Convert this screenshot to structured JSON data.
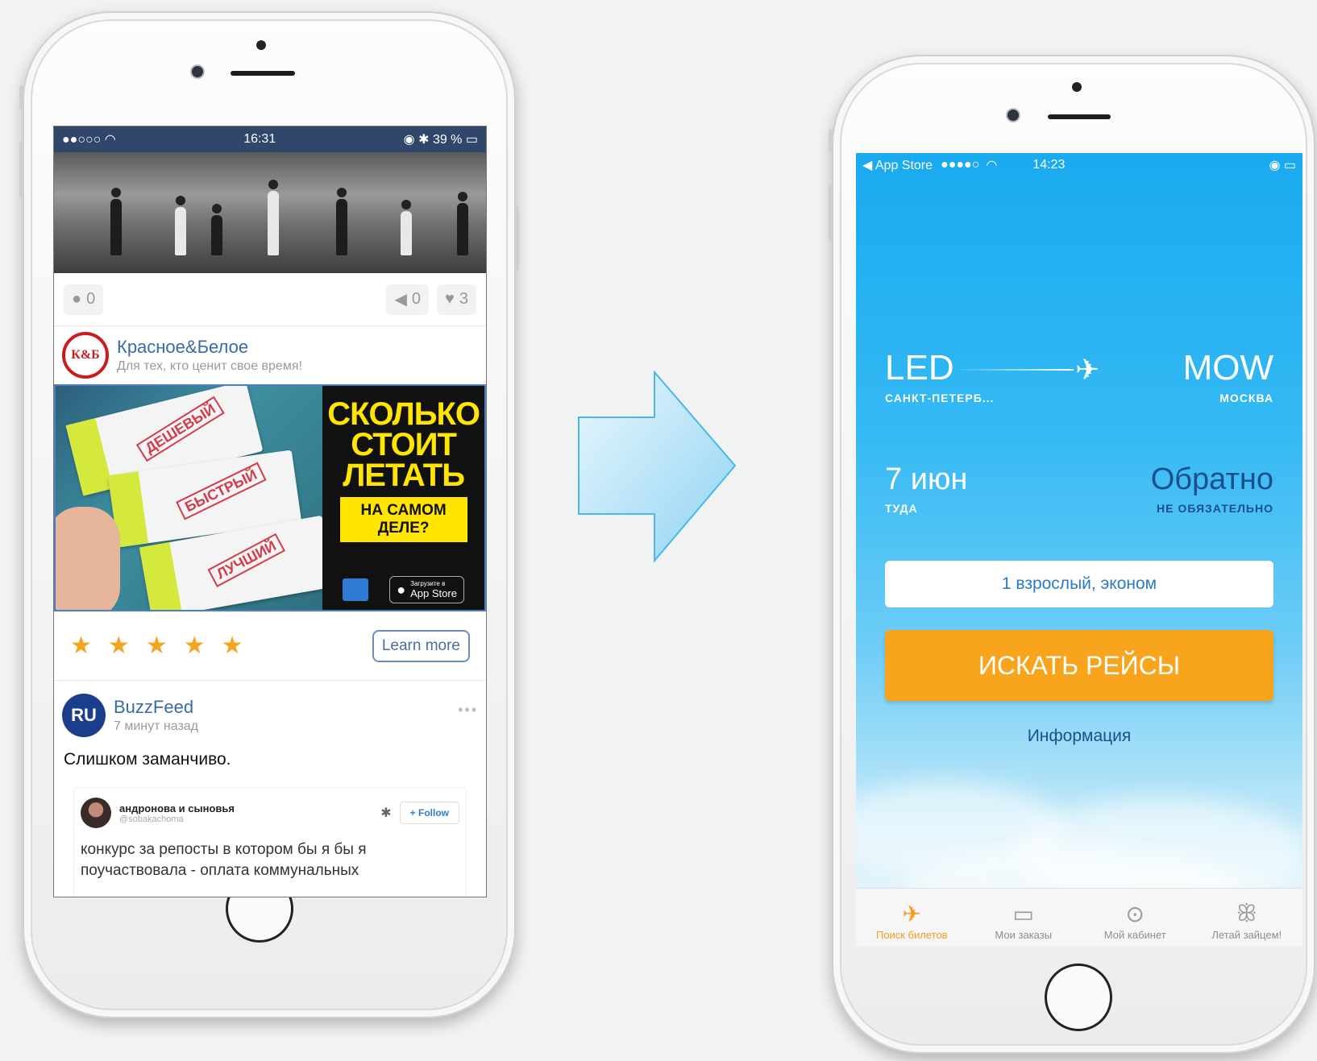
{
  "left_phone": {
    "status": {
      "signal": "●●○○○",
      "wifi": "wifi-icon",
      "time": "16:31",
      "right": "39 %"
    },
    "actions": {
      "comments": "0",
      "reposts": "0",
      "likes": "3"
    },
    "ad_post": {
      "brand_name": "Красное&Белое",
      "brand_tagline": "Для тех, кто ценит свое время!",
      "avatar_text": "К&Б",
      "creative": {
        "headline_1": "СКОЛЬКО",
        "headline_2": "СТОИТ",
        "headline_3": "ЛЕТАТЬ",
        "box_1": "НА САМОМ",
        "box_2": "ДЕЛЕ?",
        "stamp_1": "ДЕШЕВЫЙ",
        "stamp_2": "БЫСТРЫЙ",
        "stamp_3": "ЛУЧШИЙ",
        "store_small": "Загрузите в",
        "store_big": "App Store"
      },
      "stars": [
        "★",
        "★",
        "★",
        "★",
        "★"
      ],
      "learn_more": "Learn more"
    },
    "buzz_post": {
      "name": "BuzzFeed",
      "avatar_text": "RU",
      "time": "7 минут назад",
      "more": "•••",
      "text": "Слишком заманчиво.",
      "tweet": {
        "name": "андронова и сыновья",
        "handle": "@sobakachoma",
        "follow": "Follow",
        "text": "конкурс за репосты в котором бы я бы я поучаствовала - оплата коммунальных"
      }
    }
  },
  "right_phone": {
    "status": {
      "back": "App Store",
      "signal": "●●●●○",
      "time": "14:23"
    },
    "from_code": "LED",
    "from_city": "САНКТ-ПЕТЕРБ...",
    "to_code": "MOW",
    "to_city": "МОСКВА",
    "date_value": "7 июн",
    "date_label": "ТУДА",
    "back_value": "Обратно",
    "back_label": "НЕ ОБЯЗАТЕЛЬНО",
    "passengers": "1 взрослый, эконом",
    "search_button": "ИСКАТЬ РЕЙСЫ",
    "info_link": "Информация",
    "tabs": [
      {
        "label": "Поиск билетов",
        "icon": "plane-icon",
        "active": true
      },
      {
        "label": "Мои заказы",
        "icon": "tickets-icon",
        "active": false
      },
      {
        "label": "Мой кабинет",
        "icon": "keyhole-icon",
        "active": false
      },
      {
        "label": "Летай зайцем!",
        "icon": "bunny-icon",
        "active": false
      }
    ]
  },
  "colors": {
    "accent_orange": "#f8a41c",
    "sky_blue": "#1aaaf0",
    "vk_header": "#30466a",
    "ad_yellow": "#ffe500"
  }
}
